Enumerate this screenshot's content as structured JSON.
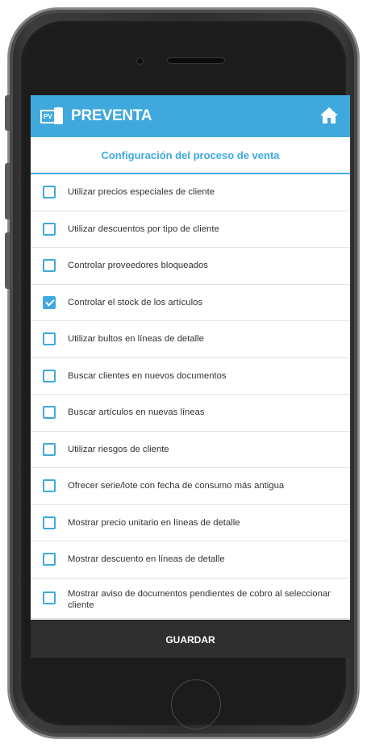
{
  "header": {
    "logo_text": "PV",
    "title": "PREVENTA",
    "home_icon": "home-icon"
  },
  "section": {
    "title": "Configuración del proceso de venta"
  },
  "options": [
    {
      "label": "Utilizar precios especiales de cliente",
      "checked": false
    },
    {
      "label": "Utilizar descuentos por tipo de cliente",
      "checked": false
    },
    {
      "label": "Controlar proveedores bloqueados",
      "checked": false
    },
    {
      "label": "Controlar el stock de los artículos",
      "checked": true
    },
    {
      "label": "Utilizar bultos en líneas de detalle",
      "checked": false
    },
    {
      "label": "Buscar clientes en nuevos documentos",
      "checked": false
    },
    {
      "label": "Buscar artículos en nuevas líneas",
      "checked": false
    },
    {
      "label": "Utilizar riesgos de cliente",
      "checked": false
    },
    {
      "label": "Ofrecer serie/lote con fecha de consumo más antigua",
      "checked": false
    },
    {
      "label": "Mostrar precio unitario en líneas de detalle",
      "checked": false
    },
    {
      "label": "Mostrar descuento en líneas de detalle",
      "checked": false
    },
    {
      "label": "Mostrar aviso de documentos pendientes de cobro al seleccionar cliente",
      "checked": false
    }
  ],
  "footer": {
    "save_label": "GUARDAR"
  },
  "colors": {
    "accent": "#3fa9dd",
    "footer_bg": "#2f2f2f",
    "text": "#333333"
  }
}
